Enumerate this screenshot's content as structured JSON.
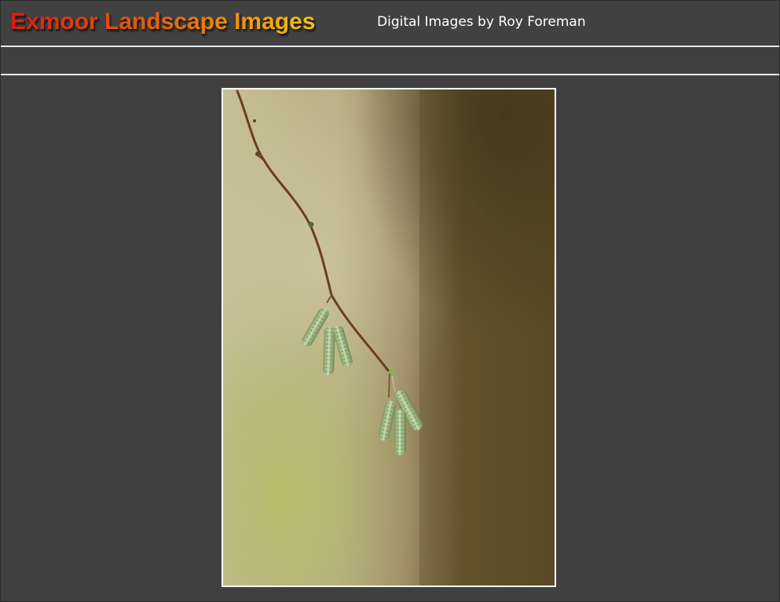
{
  "header": {
    "title": "Exmoor Landscape Images",
    "subtitle": "Digital Images by Roy Foreman"
  },
  "photo": {
    "subject": "hazel-catkins-on-twig",
    "colors": {
      "frame_border": "#ffffff",
      "background_green": "#b6b27c",
      "background_brown": "#7e6a47",
      "catkin_green": "#a6c08a",
      "twig_brown": "#6b3e22"
    }
  },
  "theme": {
    "page_background": "#404040",
    "rule_color": "#e8e8e8",
    "title_gradient": [
      "#d71f0e",
      "#e8740e",
      "#f6c016"
    ],
    "subtitle_color": "#ffffff"
  }
}
